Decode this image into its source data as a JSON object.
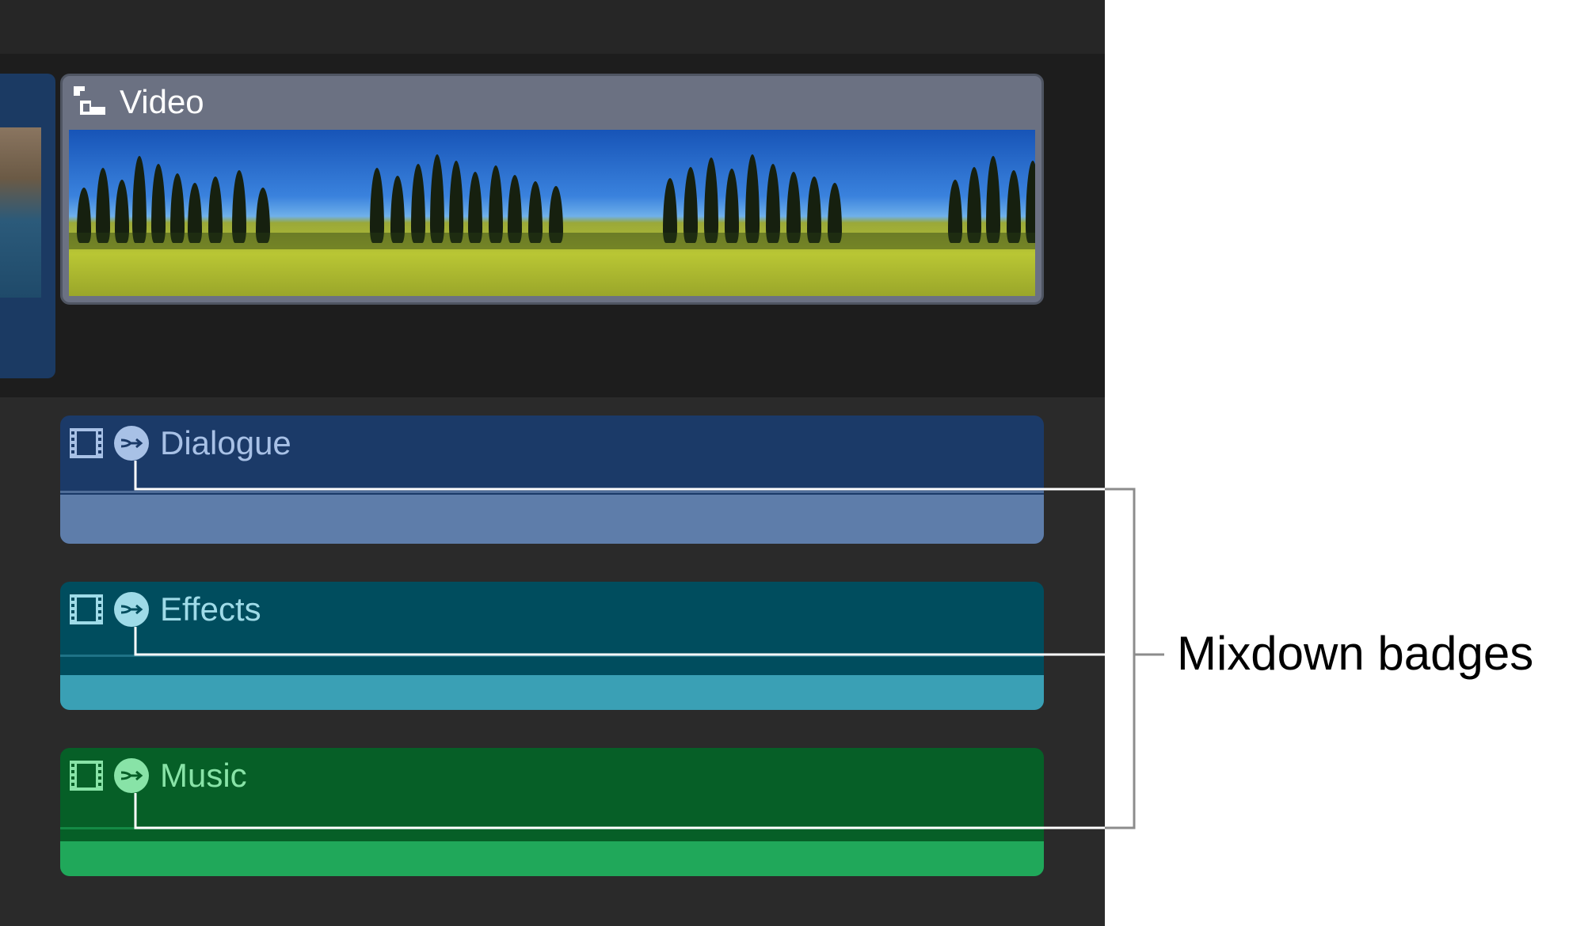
{
  "timeline": {
    "video_clip": {
      "title": "Video",
      "frame_count": 4
    },
    "audio_clips": [
      {
        "id": "dialogue",
        "title": "Dialogue",
        "color": "#1b3a68"
      },
      {
        "id": "effects",
        "title": "Effects",
        "color": "#004d5e"
      },
      {
        "id": "music",
        "title": "Music",
        "color": "#065f27"
      }
    ]
  },
  "callout": {
    "label": "Mixdown badges"
  },
  "icons": {
    "video_clip_icon": "connected-clip-icon",
    "audio_clip_icon": "film-strip-icon",
    "badge_icon": "mixdown-badge-icon"
  }
}
